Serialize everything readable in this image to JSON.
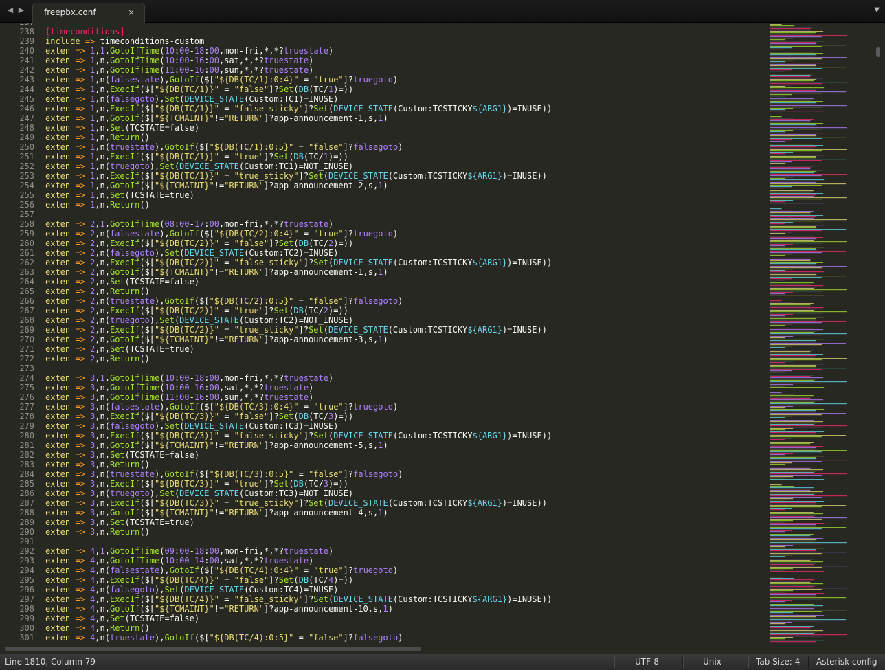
{
  "tabs": [
    {
      "title": "freepbx.conf"
    }
  ],
  "nav": {
    "back_icon": "◀",
    "forward_icon": "▶",
    "close_icon": "×",
    "dropdown_icon": "▼"
  },
  "editor": {
    "first_line_number": 238,
    "lines": [
      "[timeconditions]",
      "include => timeconditions-custom",
      "exten => 1,1,GotoIfTime(10:00-18:00,mon-fri,*,*?truestate)",
      "exten => 1,n,GotoIfTime(10:00-16:00,sat,*,*?truestate)",
      "exten => 1,n,GotoIfTime(11:00-16:00,sun,*,*?truestate)",
      "exten => 1,n(falsestate),GotoIf($[\"${DB(TC/1):0:4}\" = \"true\"]?truegoto)",
      "exten => 1,n,ExecIf($[\"${DB(TC/1)}\" = \"false\"]?Set(DB(TC/1)=))",
      "exten => 1,n(falsegoto),Set(DEVICE_STATE(Custom:TC1)=INUSE)",
      "exten => 1,n,ExecIf($[\"${DB(TC/1)}\" = \"false_sticky\"]?Set(DEVICE_STATE(Custom:TCSTICKY${ARG1})=INUSE))",
      "exten => 1,n,GotoIf($[\"${TCMAINT}\"!=\"RETURN\"]?app-announcement-1,s,1)",
      "exten => 1,n,Set(TCSTATE=false)",
      "exten => 1,n,Return()",
      "exten => 1,n(truestate),GotoIf($[\"${DB(TC/1):0:5}\" = \"false\"]?falsegoto)",
      "exten => 1,n,ExecIf($[\"${DB(TC/1)}\" = \"true\"]?Set(DB(TC/1)=))",
      "exten => 1,n(truegoto),Set(DEVICE_STATE(Custom:TC1)=NOT_INUSE)",
      "exten => 1,n,ExecIf($[\"${DB(TC/1)}\" = \"true_sticky\"]?Set(DEVICE_STATE(Custom:TCSTICKY${ARG1})=INUSE))",
      "exten => 1,n,GotoIf($[\"${TCMAINT}\"!=\"RETURN\"]?app-announcement-2,s,1)",
      "exten => 1,n,Set(TCSTATE=true)",
      "exten => 1,n,Return()",
      "",
      "exten => 2,1,GotoIfTime(08:00-17:00,mon-fri,*,*?truestate)",
      "exten => 2,n(falsestate),GotoIf($[\"${DB(TC/2):0:4}\" = \"true\"]?truegoto)",
      "exten => 2,n,ExecIf($[\"${DB(TC/2)}\" = \"false\"]?Set(DB(TC/2)=))",
      "exten => 2,n(falsegoto),Set(DEVICE_STATE(Custom:TC2)=INUSE)",
      "exten => 2,n,ExecIf($[\"${DB(TC/2)}\" = \"false_sticky\"]?Set(DEVICE_STATE(Custom:TCSTICKY${ARG1})=INUSE))",
      "exten => 2,n,GotoIf($[\"${TCMAINT}\"!=\"RETURN\"]?app-announcement-1,s,1)",
      "exten => 2,n,Set(TCSTATE=false)",
      "exten => 2,n,Return()",
      "exten => 2,n(truestate),GotoIf($[\"${DB(TC/2):0:5}\" = \"false\"]?falsegoto)",
      "exten => 2,n,ExecIf($[\"${DB(TC/2)}\" = \"true\"]?Set(DB(TC/2)=))",
      "exten => 2,n(truegoto),Set(DEVICE_STATE(Custom:TC2)=NOT_INUSE)",
      "exten => 2,n,ExecIf($[\"${DB(TC/2)}\" = \"true_sticky\"]?Set(DEVICE_STATE(Custom:TCSTICKY${ARG1})=INUSE))",
      "exten => 2,n,GotoIf($[\"${TCMAINT}\"!=\"RETURN\"]?app-announcement-3,s,1)",
      "exten => 2,n,Set(TCSTATE=true)",
      "exten => 2,n,Return()",
      "",
      "exten => 3,1,GotoIfTime(10:00-18:00,mon-fri,*,*?truestate)",
      "exten => 3,n,GotoIfTime(10:00-16:00,sat,*,*?truestate)",
      "exten => 3,n,GotoIfTime(11:00-16:00,sun,*,*?truestate)",
      "exten => 3,n(falsestate),GotoIf($[\"${DB(TC/3):0:4}\" = \"true\"]?truegoto)",
      "exten => 3,n,ExecIf($[\"${DB(TC/3)}\" = \"false\"]?Set(DB(TC/3)=))",
      "exten => 3,n(falsegoto),Set(DEVICE_STATE(Custom:TC3)=INUSE)",
      "exten => 3,n,ExecIf($[\"${DB(TC/3)}\" = \"false_sticky\"]?Set(DEVICE_STATE(Custom:TCSTICKY${ARG1})=INUSE))",
      "exten => 3,n,GotoIf($[\"${TCMAINT}\"!=\"RETURN\"]?app-announcement-5,s,1)",
      "exten => 3,n,Set(TCSTATE=false)",
      "exten => 3,n,Return()",
      "exten => 3,n(truestate),GotoIf($[\"${DB(TC/3):0:5}\" = \"false\"]?falsegoto)",
      "exten => 3,n,ExecIf($[\"${DB(TC/3)}\" = \"true\"]?Set(DB(TC/3)=))",
      "exten => 3,n(truegoto),Set(DEVICE_STATE(Custom:TC3)=NOT_INUSE)",
      "exten => 3,n,ExecIf($[\"${DB(TC/3)}\" = \"true_sticky\"]?Set(DEVICE_STATE(Custom:TCSTICKY${ARG1})=INUSE))",
      "exten => 3,n,GotoIf($[\"${TCMAINT}\"!=\"RETURN\"]?app-announcement-4,s,1)",
      "exten => 3,n,Set(TCSTATE=true)",
      "exten => 3,n,Return()",
      "",
      "exten => 4,1,GotoIfTime(09:00-18:00,mon-fri,*,*?truestate)",
      "exten => 4,n,GotoIfTime(10:00-14:00,sat,*,*?truestate)",
      "exten => 4,n(falsestate),GotoIf($[\"${DB(TC/4):0:4}\" = \"true\"]?truegoto)",
      "exten => 4,n,ExecIf($[\"${DB(TC/4)}\" = \"false\"]?Set(DB(TC/4)=))",
      "exten => 4,n(falsegoto),Set(DEVICE_STATE(Custom:TC4)=INUSE)",
      "exten => 4,n,ExecIf($[\"${DB(TC/4)}\" = \"false_sticky\"]?Set(DEVICE_STATE(Custom:TCSTICKY${ARG1})=INUSE))",
      "exten => 4,n,GotoIf($[\"${TCMAINT}\"!=\"RETURN\"]?app-announcement-10,s,1)",
      "exten => 4,n,Set(TCSTATE=false)",
      "exten => 4,n,Return()",
      "exten => 4,n(truestate),GotoIf($[\"${DB(TC/4):0:5}\" = \"false\"]?falsegoto)"
    ]
  },
  "status": {
    "position": "Line 1810, Column 79",
    "encoding": "UTF-8",
    "line_endings": "Unix",
    "indent": "Tab Size: 4",
    "syntax": "Asterisk config"
  },
  "colors": {
    "background": "#272822",
    "keyword": "#f92672",
    "string": "#e6db74",
    "function": "#a6e22e",
    "variable": "#66d9ef",
    "number": "#ae81ff",
    "operator": "#fd971f"
  }
}
